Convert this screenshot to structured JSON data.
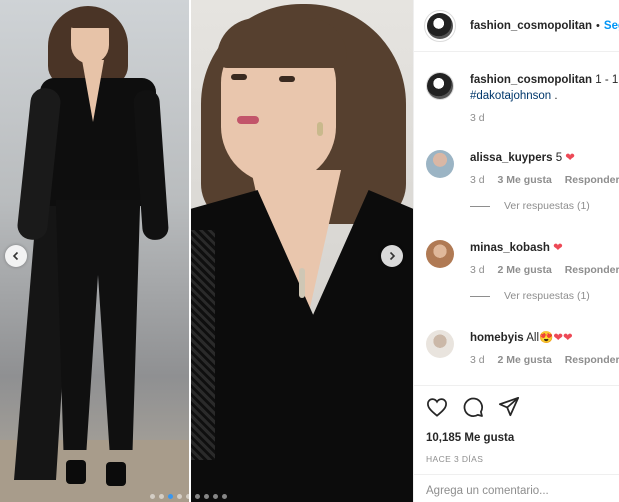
{
  "carousel": {
    "prev_icon": "chevron-left-icon",
    "next_icon": "chevron-right-icon",
    "slide_count": 9,
    "active_slide": 3
  },
  "post_header": {
    "username": "fashion_cosmopolitan",
    "separator": "•",
    "follow_label": "Seg"
  },
  "caption": {
    "username": "fashion_cosmopolitan",
    "text": "1 - 1",
    "hashtag": "#dakotajohnson",
    "trailing": " .",
    "time": "3 d"
  },
  "comments": [
    {
      "username": "alissa_kuypers",
      "text": "5",
      "emoji": "❤",
      "time": "3 d",
      "likes": "3 Me gusta",
      "reply_label": "Responder",
      "view_replies": "Ver respuestas (1)"
    },
    {
      "username": "minas_kobash",
      "text": "",
      "emoji": "❤",
      "time": "3 d",
      "likes": "2 Me gusta",
      "reply_label": "Responder",
      "view_replies": "Ver respuestas (1)"
    },
    {
      "username": "homebyis",
      "text": "All",
      "emoji": "😍❤❤",
      "time": "3 d",
      "likes": "2 Me gusta",
      "reply_label": "Responder"
    }
  ],
  "actions": {
    "like_icon": "heart-icon",
    "comment_icon": "comment-icon",
    "share_icon": "share-icon",
    "likes_count": "10,185 Me gusta",
    "date": "HACE 3 DÍAS"
  },
  "add_comment": {
    "placeholder": "Agrega un comentario..."
  },
  "colors": {
    "link": "#0095f6",
    "heart": "#ed4956",
    "muted": "#8e8e8e"
  }
}
